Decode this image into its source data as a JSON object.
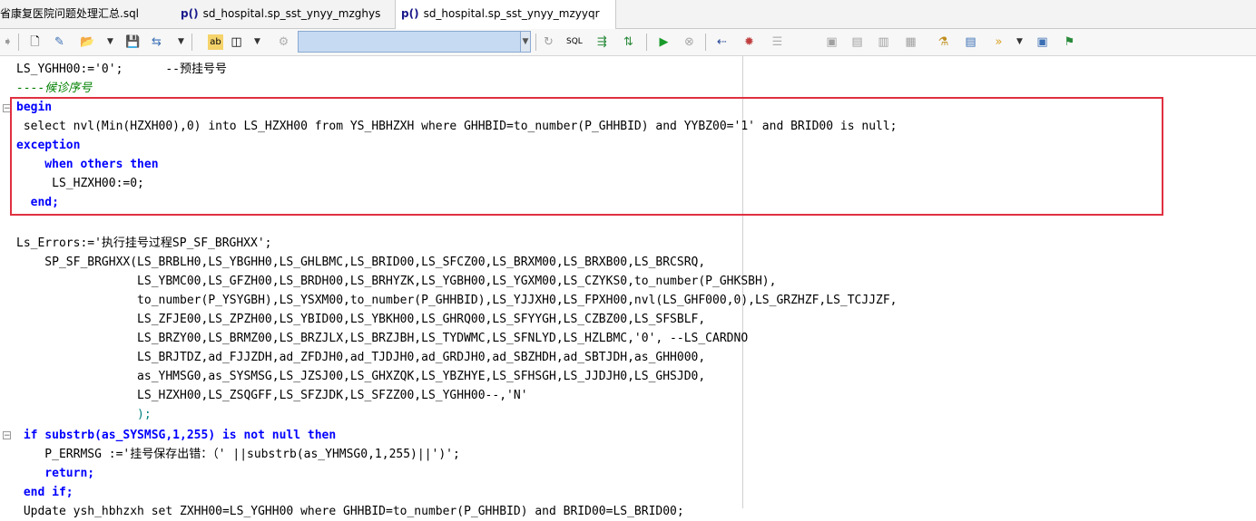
{
  "tabs": [
    {
      "label": "省康复医院问题处理汇总.sql",
      "prefix": ""
    },
    {
      "label": "sd_hospital.sp_sst_ynyy_mzghys",
      "prefix": "p()"
    },
    {
      "label": "sd_hospital.sp_sst_ynyy_mzyyqr",
      "prefix": "p()"
    }
  ],
  "toolbar": {
    "icons": [
      "back-arrow-icon",
      "new-file-icon",
      "open-wizard-icon",
      "open-folder-icon",
      "save-icon",
      "save-options-icon",
      "code-format-icon",
      "window-layout-icon",
      "gear-disabled-icon",
      "refresh-icon",
      "sql-icon",
      "history-icon",
      "explain-icon",
      "run-icon",
      "stop-icon",
      "comment-icon",
      "debug-icon",
      "list-icon",
      "compile-icon",
      "find-icon",
      "replace-icon",
      "compare-icon",
      "sort-icon",
      "outline-icon",
      "forward-icon",
      "report-icon",
      "extra-icon"
    ],
    "object_combo_value": ""
  },
  "code": [
    "LS_YGHH00:='0';      --预挂号号",
    "----候诊序号",
    "begin",
    " select nvl(Min(HZXH00),0) into LS_HZXH00 from YS_HBHZXH where GHHBID=to_number(P_GHHBID) and YYBZ00='1' and BRID00 is null;",
    "exception",
    "    when others then",
    "     LS_HZXH00:=0;",
    "  end;",
    "",
    "Ls_Errors:='执行挂号过程SP_SF_BRGHXX';",
    "    SP_SF_BRGHXX(LS_BRBLH0,LS_YBGHH0,LS_GHLBMC,LS_BRID00,LS_SFCZ00,LS_BRXM00,LS_BRXB00,LS_BRCSRQ,",
    "                 LS_YBMC00,LS_GFZH00,LS_BRDH00,LS_BRHYZK,LS_YGBH00,LS_YGXM00,LS_CZYKS0,to_number(P_GHKSBH),",
    "                 to_number(P_YSYGBH),LS_YSXM00,to_number(P_GHHBID),LS_YJJXH0,LS_FPXH00,nvl(LS_GHF000,0),LS_GRZHZF,LS_TCJJZF,",
    "                 LS_ZFJE00,LS_ZPZH00,LS_YBID00,LS_YBKH00,LS_GHRQ00,LS_SFYYGH,LS_CZBZ00,LS_SFSBLF,",
    "                 LS_BRZY00,LS_BRMZ00,LS_BRZJLX,LS_BRZJBH,LS_TYDWMC,LS_SFNLYD,LS_HZLBMC,'0', --LS_CARDNO",
    "                 LS_BRJTDZ,ad_FJJZDH,ad_ZFDJH0,ad_TJDJH0,ad_GRDJH0,ad_SBZHDH,ad_SBTJDH,as_GHH000,",
    "                 as_YHMSG0,as_SYSMSG,LS_JZSJ00,LS_GHXZQK,LS_YBZHYE,LS_SFHSGH,LS_JJDJH0,LS_GHSJD0,",
    "                 LS_HZXH00,LS_ZSQGFF,LS_SFZJDK,LS_SFZZ00,LS_YGHH00--,'N'",
    "                 );",
    " if substrb(as_SYSMSG,1,255) is not null then",
    "    P_ERRMSG :='挂号保存出错：（' ||substrb(as_YHMSG0,1,255)||')';",
    "    return;",
    " end if;",
    " Update ysh_hbhzxh set ZXHH00=LS_YGHH00 where GHHBID=to_number(P_GHHBID) and BRID00=LS_BRID00;"
  ]
}
